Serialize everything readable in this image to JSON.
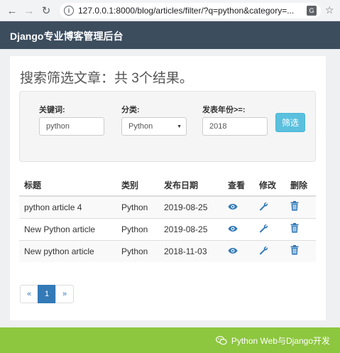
{
  "browser": {
    "url": "127.0.0.1:8000/blog/articles/filter/?q=python&category=..."
  },
  "navbar": {
    "brand": "Django专业博客管理后台"
  },
  "main": {
    "heading": "搜索筛选文章：共 3个结果。",
    "filter": {
      "keyword_label": "关键词:",
      "keyword_value": "python",
      "category_label": "分类:",
      "category_value": "Python",
      "year_label": "发表年份>=:",
      "year_value": "2018",
      "submit_label": "筛选"
    },
    "table": {
      "headers": [
        "标题",
        "类别",
        "发布日期",
        "查看",
        "修改",
        "删除"
      ],
      "rows": [
        {
          "title": "python article 4",
          "category": "Python",
          "date": "2019-08-25"
        },
        {
          "title": "New Python article",
          "category": "Python",
          "date": "2019-08-25"
        },
        {
          "title": "New python article",
          "category": "Python",
          "date": "2018-11-03"
        }
      ]
    },
    "pagination": {
      "prev": "«",
      "current": "1",
      "next": "»"
    }
  },
  "watermark": {
    "text": "Python Web与Django开发"
  },
  "icons": {
    "view": "eye-icon",
    "edit": "wrench-icon",
    "delete": "trash-icon"
  },
  "colors": {
    "navbar": "#3c4d5e",
    "accent": "#337ab7",
    "filter_button": "#5bc0de",
    "footer": "#8dc63f"
  }
}
